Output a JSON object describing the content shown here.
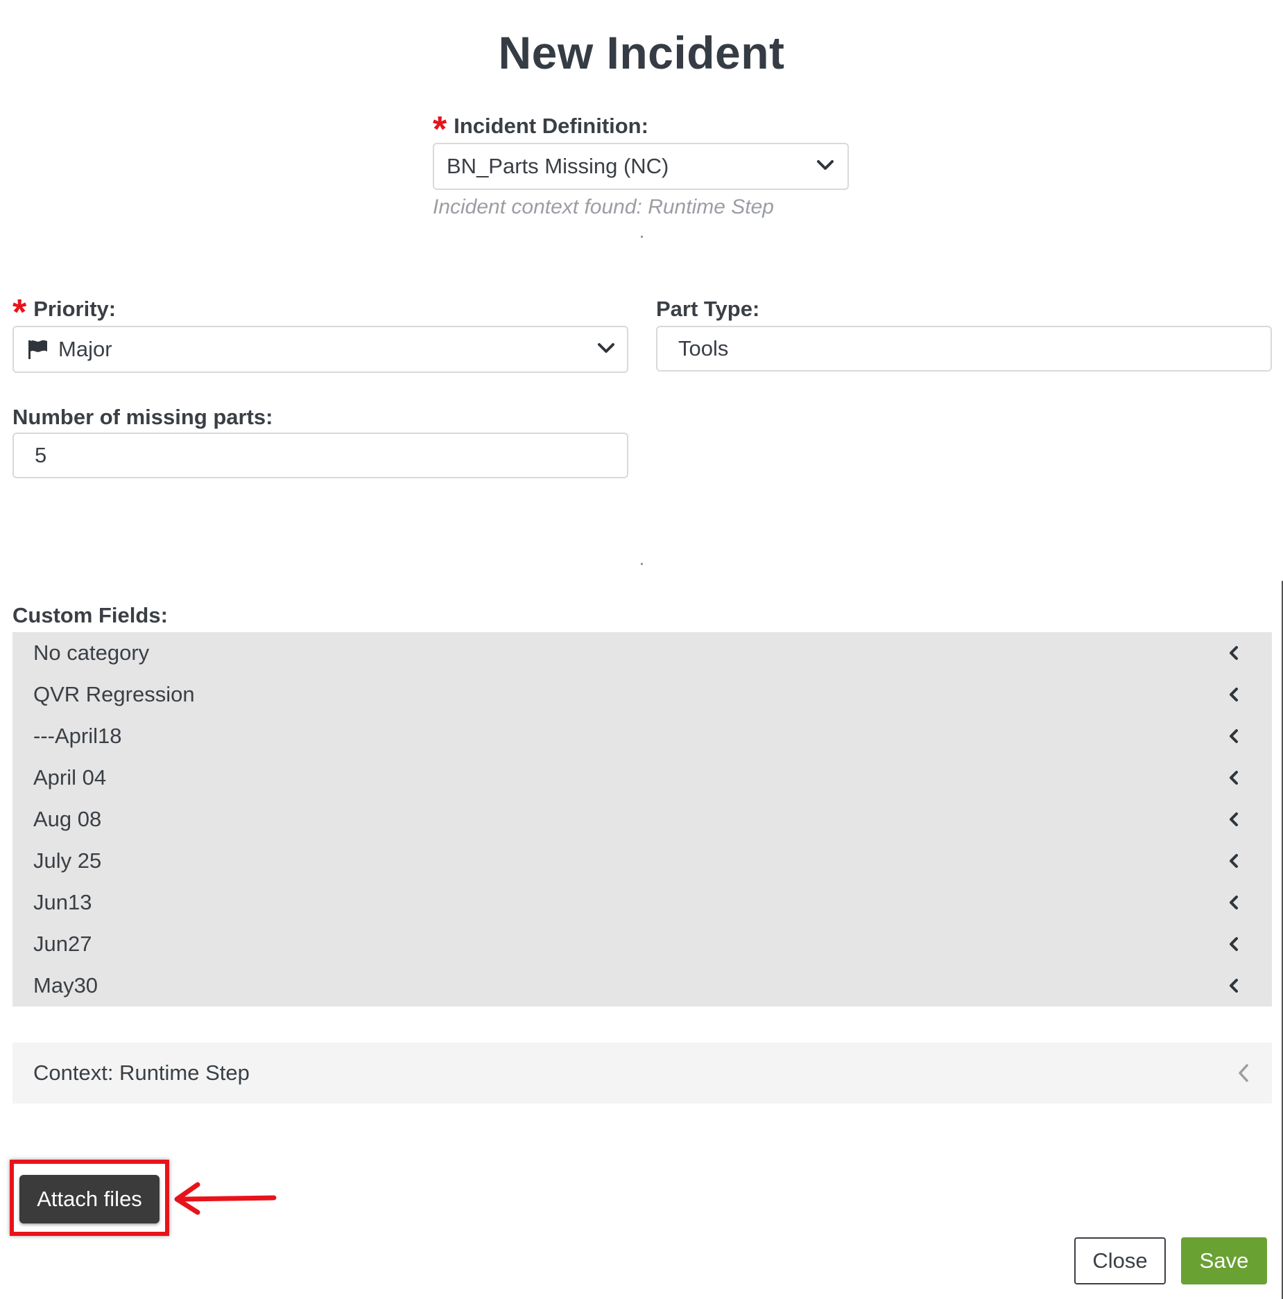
{
  "title": "New Incident",
  "incident_definition": {
    "label": "Incident Definition:",
    "required_mark": "*",
    "value": "BN_Parts Missing (NC)",
    "hint": "Incident context found: Runtime Step"
  },
  "priority": {
    "label": "Priority:",
    "required_mark": "*",
    "value": "Major",
    "icon": "flag-icon"
  },
  "part_type": {
    "label": "Part Type:",
    "value": "Tools"
  },
  "missing_parts": {
    "label": "Number of missing parts:",
    "value": "5"
  },
  "custom_fields": {
    "label": "Custom Fields:",
    "items": [
      "No category",
      "QVR Regression",
      "---April18",
      "April 04",
      "Aug 08",
      "July 25",
      "Jun13",
      "Jun27",
      "May30"
    ]
  },
  "context": {
    "label": "Context: Runtime Step"
  },
  "buttons": {
    "attach": "Attach files",
    "close": "Close",
    "save": "Save"
  },
  "colors": {
    "required": "#e8131a",
    "save": "#6aa133",
    "attach": "#3b3b3b",
    "annotation": "#e8131a"
  }
}
